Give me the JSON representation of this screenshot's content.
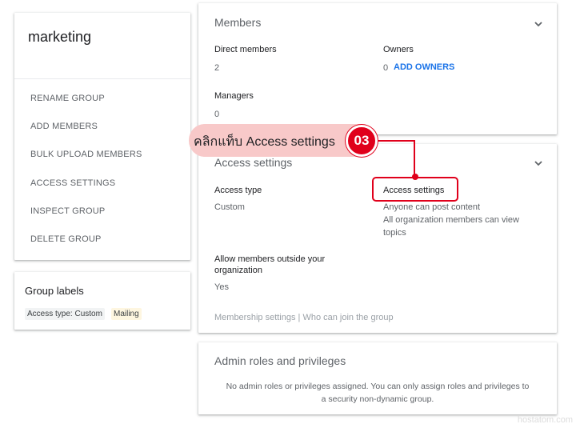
{
  "group": {
    "name": "marketing",
    "menu": [
      "RENAME GROUP",
      "ADD MEMBERS",
      "BULK UPLOAD MEMBERS",
      "ACCESS SETTINGS",
      "INSPECT GROUP",
      "DELETE GROUP"
    ]
  },
  "labels": {
    "title": "Group labels",
    "chips": [
      "Access type: Custom",
      "Mailing"
    ]
  },
  "members": {
    "title": "Members",
    "direct_label": "Direct members",
    "direct_value": "2",
    "owners_label": "Owners",
    "owners_value": "0",
    "add_owners": "ADD OWNERS",
    "managers_label": "Managers",
    "managers_value": "0"
  },
  "access": {
    "title": "Access settings",
    "type_label": "Access type",
    "type_value": "Custom",
    "settings_label": "Access settings",
    "settings_line1": "Anyone can post content",
    "settings_line2": "All organization members can view",
    "settings_line3": "topics",
    "outside_label_1": "Allow members outside your",
    "outside_label_2": "organization",
    "outside_value": "Yes",
    "footer": "Membership settings | Who can join the group"
  },
  "admin": {
    "title": "Admin roles and privileges",
    "text_1": "No admin roles or privileges assigned. You can only assign roles and privileges to",
    "text_2": "a security non-dynamic group."
  },
  "callout": {
    "text": "คลิกแท็บ Access settings",
    "step": "03",
    "color": "#e0001b",
    "bubble_color": "#f8c9c9"
  },
  "watermark": "hostatom.com"
}
